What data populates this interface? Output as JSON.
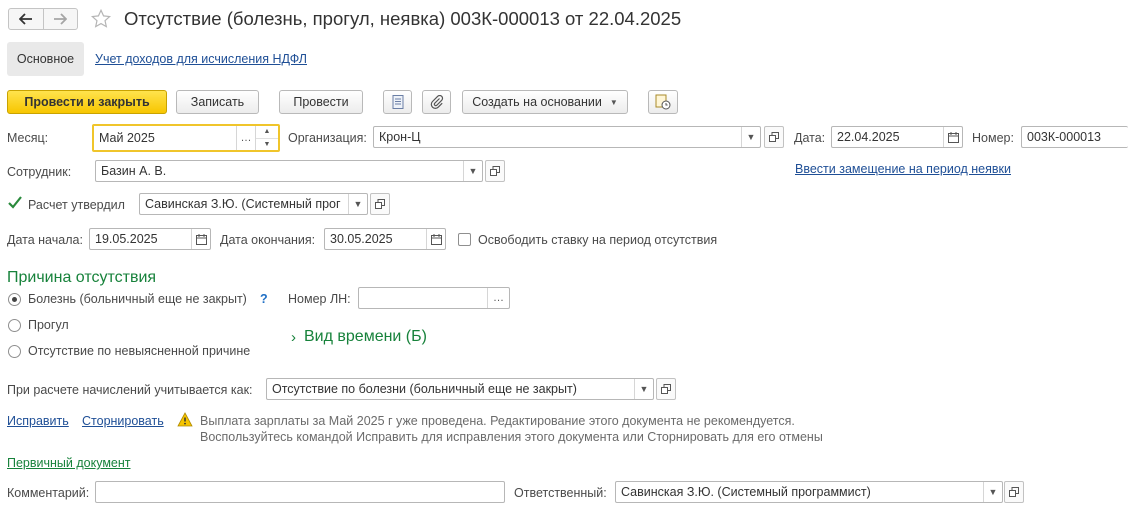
{
  "header": {
    "back_icon": "arrow-left-icon",
    "forward_icon": "arrow-right-icon",
    "favorite_icon": "star-icon",
    "title": "Отсутствие (болезнь, прогул, неявка) 003К-000013 от 22.04.2025"
  },
  "tabs": [
    {
      "label": "Основное"
    },
    {
      "label": "Учет доходов для исчисления НДФЛ"
    }
  ],
  "toolbar": {
    "post_close": "Провести и закрыть",
    "save": "Записать",
    "post": "Провести",
    "create_based": "Создать на основании"
  },
  "fields": {
    "month_label": "Месяц:",
    "month_value": "Май 2025",
    "org_label": "Организация:",
    "org_value": "Крон-Ц",
    "date_label": "Дата:",
    "date_value": "22.04.2025",
    "number_label": "Номер:",
    "number_value": "003К-000013",
    "employee_label": "Сотрудник:",
    "employee_value": "Базин А. В.",
    "replacement_link": "Ввести замещение на период неявки",
    "approved_label": "Расчет утвердил",
    "approved_checked": true,
    "approved_value": "Савинская З.Ю. (Системный прог",
    "start_label": "Дата начала:",
    "start_value": "19.05.2025",
    "end_label": "Дата окончания:",
    "end_value": "30.05.2025",
    "free_rate_label": "Освободить ставку на период отсутствия"
  },
  "reason": {
    "title": "Причина отсутствия",
    "options": [
      {
        "label": "Болезнь (больничный еще не закрыт)",
        "selected": true
      },
      {
        "label": "Прогул",
        "selected": false
      },
      {
        "label": "Отсутствие по невыясненной причине",
        "selected": false
      }
    ],
    "help": "?",
    "ln_label": "Номер ЛН:",
    "ln_value": "",
    "time_kind": "Вид времени (Б)"
  },
  "accrual": {
    "label": "При расчете начислений учитывается как:",
    "value": "Отсутствие по болезни (больничный еще не закрыт)"
  },
  "actions": {
    "fix": "Исправить",
    "reverse": "Сторнировать",
    "warning_line1": "Выплата зарплаты за Май 2025 г уже проведена. Редактирование этого документа не рекомендуется.",
    "warning_line2": "Воспользуйтесь командой Исправить для исправления этого документа или Сторнировать для его отмены"
  },
  "primary_doc": "Первичный документ",
  "footer": {
    "comment_label": "Комментарий:",
    "comment_value": "",
    "responsible_label": "Ответственный:",
    "responsible_value": "Савинская З.Ю. (Системный программист)"
  },
  "colors": {
    "accent_yellow": "#f7c600",
    "link_blue": "#1f4f96",
    "section_green": "#17823b",
    "warning_text": "#6b6b6b"
  }
}
